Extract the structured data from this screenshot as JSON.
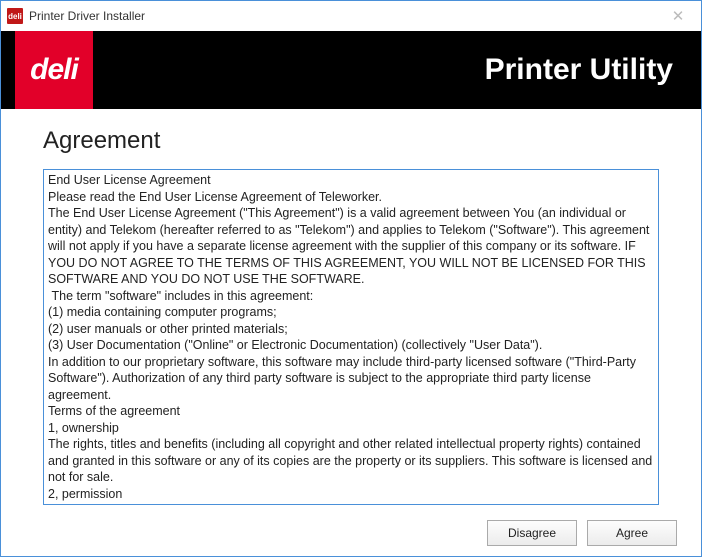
{
  "window": {
    "title": "Printer Driver Installer",
    "app_icon_text": "deli"
  },
  "banner": {
    "logo_text": "deli",
    "title": "Printer Utility"
  },
  "content": {
    "heading": "Agreement",
    "eula": "End User License Agreement\nPlease read the End User License Agreement of Teleworker.\nThe End User License Agreement (\"This Agreement\") is a valid agreement between You (an individual or entity) and Telekom (hereafter referred to as \"Telekom\") and applies to Telekom (\"Software\"). This agreement will not apply if you have a separate license agreement with the supplier of this company or its software. IF YOU DO NOT AGREE TO THE TERMS OF THIS AGREEMENT, YOU WILL NOT BE LICENSED FOR THIS SOFTWARE AND YOU DO NOT USE THE SOFTWARE.\n The term \"software\" includes in this agreement:\n(1) media containing computer programs;\n(2) user manuals or other printed materials;\n(3) User Documentation (\"Online\" or Electronic Documentation) (collectively \"User Data\").\nIn addition to our proprietary software, this software may include third-party licensed software (\"Third-Party Software\"). Authorization of any third party software is subject to the appropriate third party license agreement.\nTerms of the agreement\n1, ownership\nThe rights, titles and benefits (including all copyright and other related intellectual property rights) contained and granted in this software or any of its copies are the property or its suppliers. This software is licensed and not for sale.\n2, permission"
  },
  "footer": {
    "disagree": "Disagree",
    "agree": "Agree"
  }
}
